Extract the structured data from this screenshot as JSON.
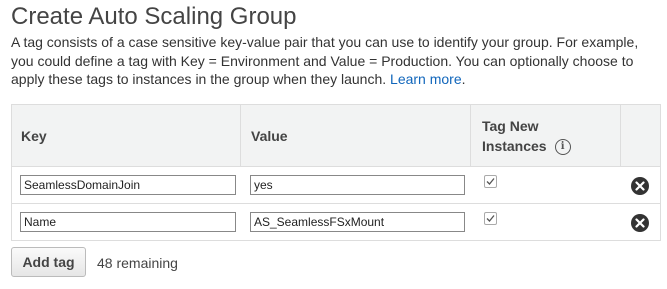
{
  "page": {
    "title": "Create Auto Scaling Group",
    "description_line1": "A tag consists of a case sensitive key-value pair that you can use to identify your group. For example,",
    "description_line2": "you could define a tag with Key = Environment and Value = Production. You can optionally choose to",
    "description_line3": "apply these tags to instances in the group when they launch. ",
    "learn_more": "Learn more",
    "learn_more_suffix": "."
  },
  "table": {
    "headers": {
      "key": "Key",
      "value": "Value",
      "tag_new_line1": "Tag New",
      "tag_new_line2": "Instances"
    },
    "rows": [
      {
        "key": "SeamlessDomainJoin",
        "value": "yes",
        "tag_new_instances": true
      },
      {
        "key": "Name",
        "value": "AS_SeamlessFSxMount",
        "tag_new_instances": true
      }
    ]
  },
  "footer": {
    "add_tag_label": "Add tag",
    "remaining": "48 remaining"
  },
  "icons": {
    "info": "info-icon",
    "remove": "remove-circle-icon",
    "check": "checkbox-check-icon"
  }
}
